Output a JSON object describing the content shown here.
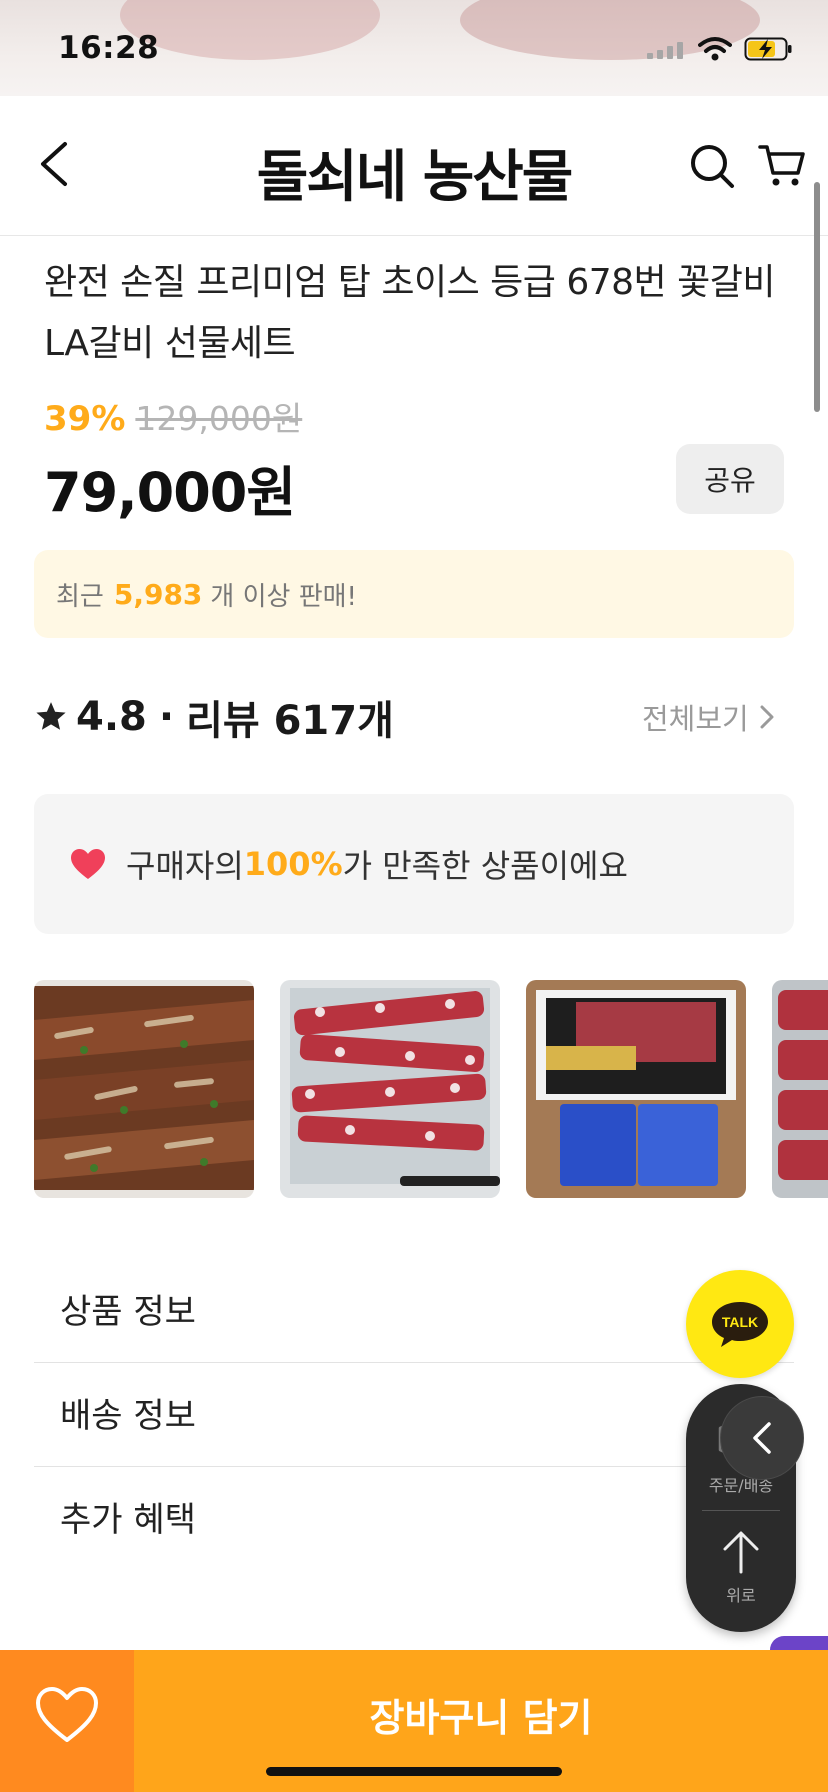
{
  "status_bar": {
    "time": "16:28"
  },
  "header": {
    "brand": "돌쇠네 농산물"
  },
  "product": {
    "title": "완전 손질 프리미엄 탑 초이스 등급 678번 꽃갈비 LA갈비 선물세트",
    "discount_rate": "39%",
    "original_price": "129,000원",
    "sale_price": "79,000원",
    "share_label": "공유"
  },
  "sales_banner": {
    "prefix": "최근",
    "count": "5,983",
    "suffix": "개 이상 판매!"
  },
  "rating": {
    "score": "4.8",
    "separator": "·",
    "reviews": "리뷰 617개",
    "view_all": "전체보기"
  },
  "satisfaction": {
    "prefix": "구매자의 ",
    "percent": "100%",
    "suffix": "가 만족한 상품이에요"
  },
  "accordion": [
    "상품 정보",
    "배송 정보",
    "추가 혜택"
  ],
  "floating": {
    "talk": "TALK",
    "order_label": "주문/배송",
    "top_label": "위로"
  },
  "bottom_bar": {
    "cart_button": "장바구니 담기"
  },
  "colors": {
    "accent": "#ffab1a",
    "cart_button": "#ffa51a",
    "wish_button": "#ff8a1f",
    "heart": "#f0405a",
    "talk": "#ffe812"
  }
}
